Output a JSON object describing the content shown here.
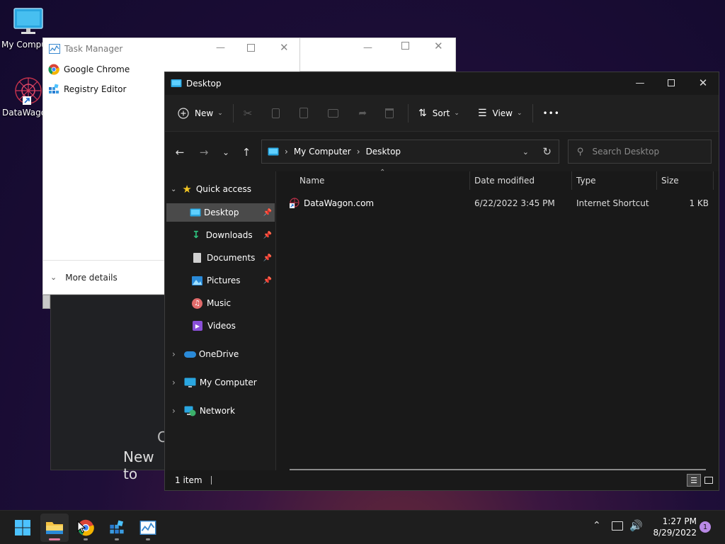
{
  "desktop": {
    "icons": [
      {
        "label": "My Computer"
      },
      {
        "label": "DataWagon.com"
      }
    ]
  },
  "task_manager": {
    "title": "Task Manager",
    "apps": [
      {
        "label": "Google Chrome"
      },
      {
        "label": "Registry Editor"
      }
    ],
    "more_details": "More details"
  },
  "browser_bg": {
    "partial_text_1": "C",
    "partial_text_2": "New to"
  },
  "explorer": {
    "title": "Desktop",
    "toolbar": {
      "new_label": "New",
      "sort_label": "Sort",
      "view_label": "View",
      "more_label": "•••"
    },
    "address": {
      "crumbs": [
        "My Computer",
        "Desktop"
      ]
    },
    "search": {
      "placeholder": "Search Desktop"
    },
    "sidebar": {
      "quick_access": "Quick access",
      "items": [
        {
          "label": "Desktop",
          "pinned": true,
          "selected": true
        },
        {
          "label": "Downloads",
          "pinned": true
        },
        {
          "label": "Documents",
          "pinned": true
        },
        {
          "label": "Pictures",
          "pinned": true
        },
        {
          "label": "Music",
          "pinned": false
        },
        {
          "label": "Videos",
          "pinned": false
        }
      ],
      "roots": [
        {
          "label": "OneDrive"
        },
        {
          "label": "My Computer"
        },
        {
          "label": "Network"
        }
      ]
    },
    "columns": [
      "Name",
      "Date modified",
      "Type",
      "Size"
    ],
    "files": [
      {
        "name": "DataWagon.com",
        "date": "6/22/2022 3:45 PM",
        "type": "Internet Shortcut",
        "size": "1 KB"
      }
    ],
    "status": "1 item"
  },
  "taskbar": {
    "time": "1:27 PM",
    "date": "8/29/2022",
    "notification_count": "1"
  },
  "colors": {
    "accent": "#4cc2ff",
    "explorer_bg": "#191919",
    "selection": "#4a4a4a",
    "taskbar": "#1e1e1e",
    "notification_badge": "#b989e6"
  }
}
